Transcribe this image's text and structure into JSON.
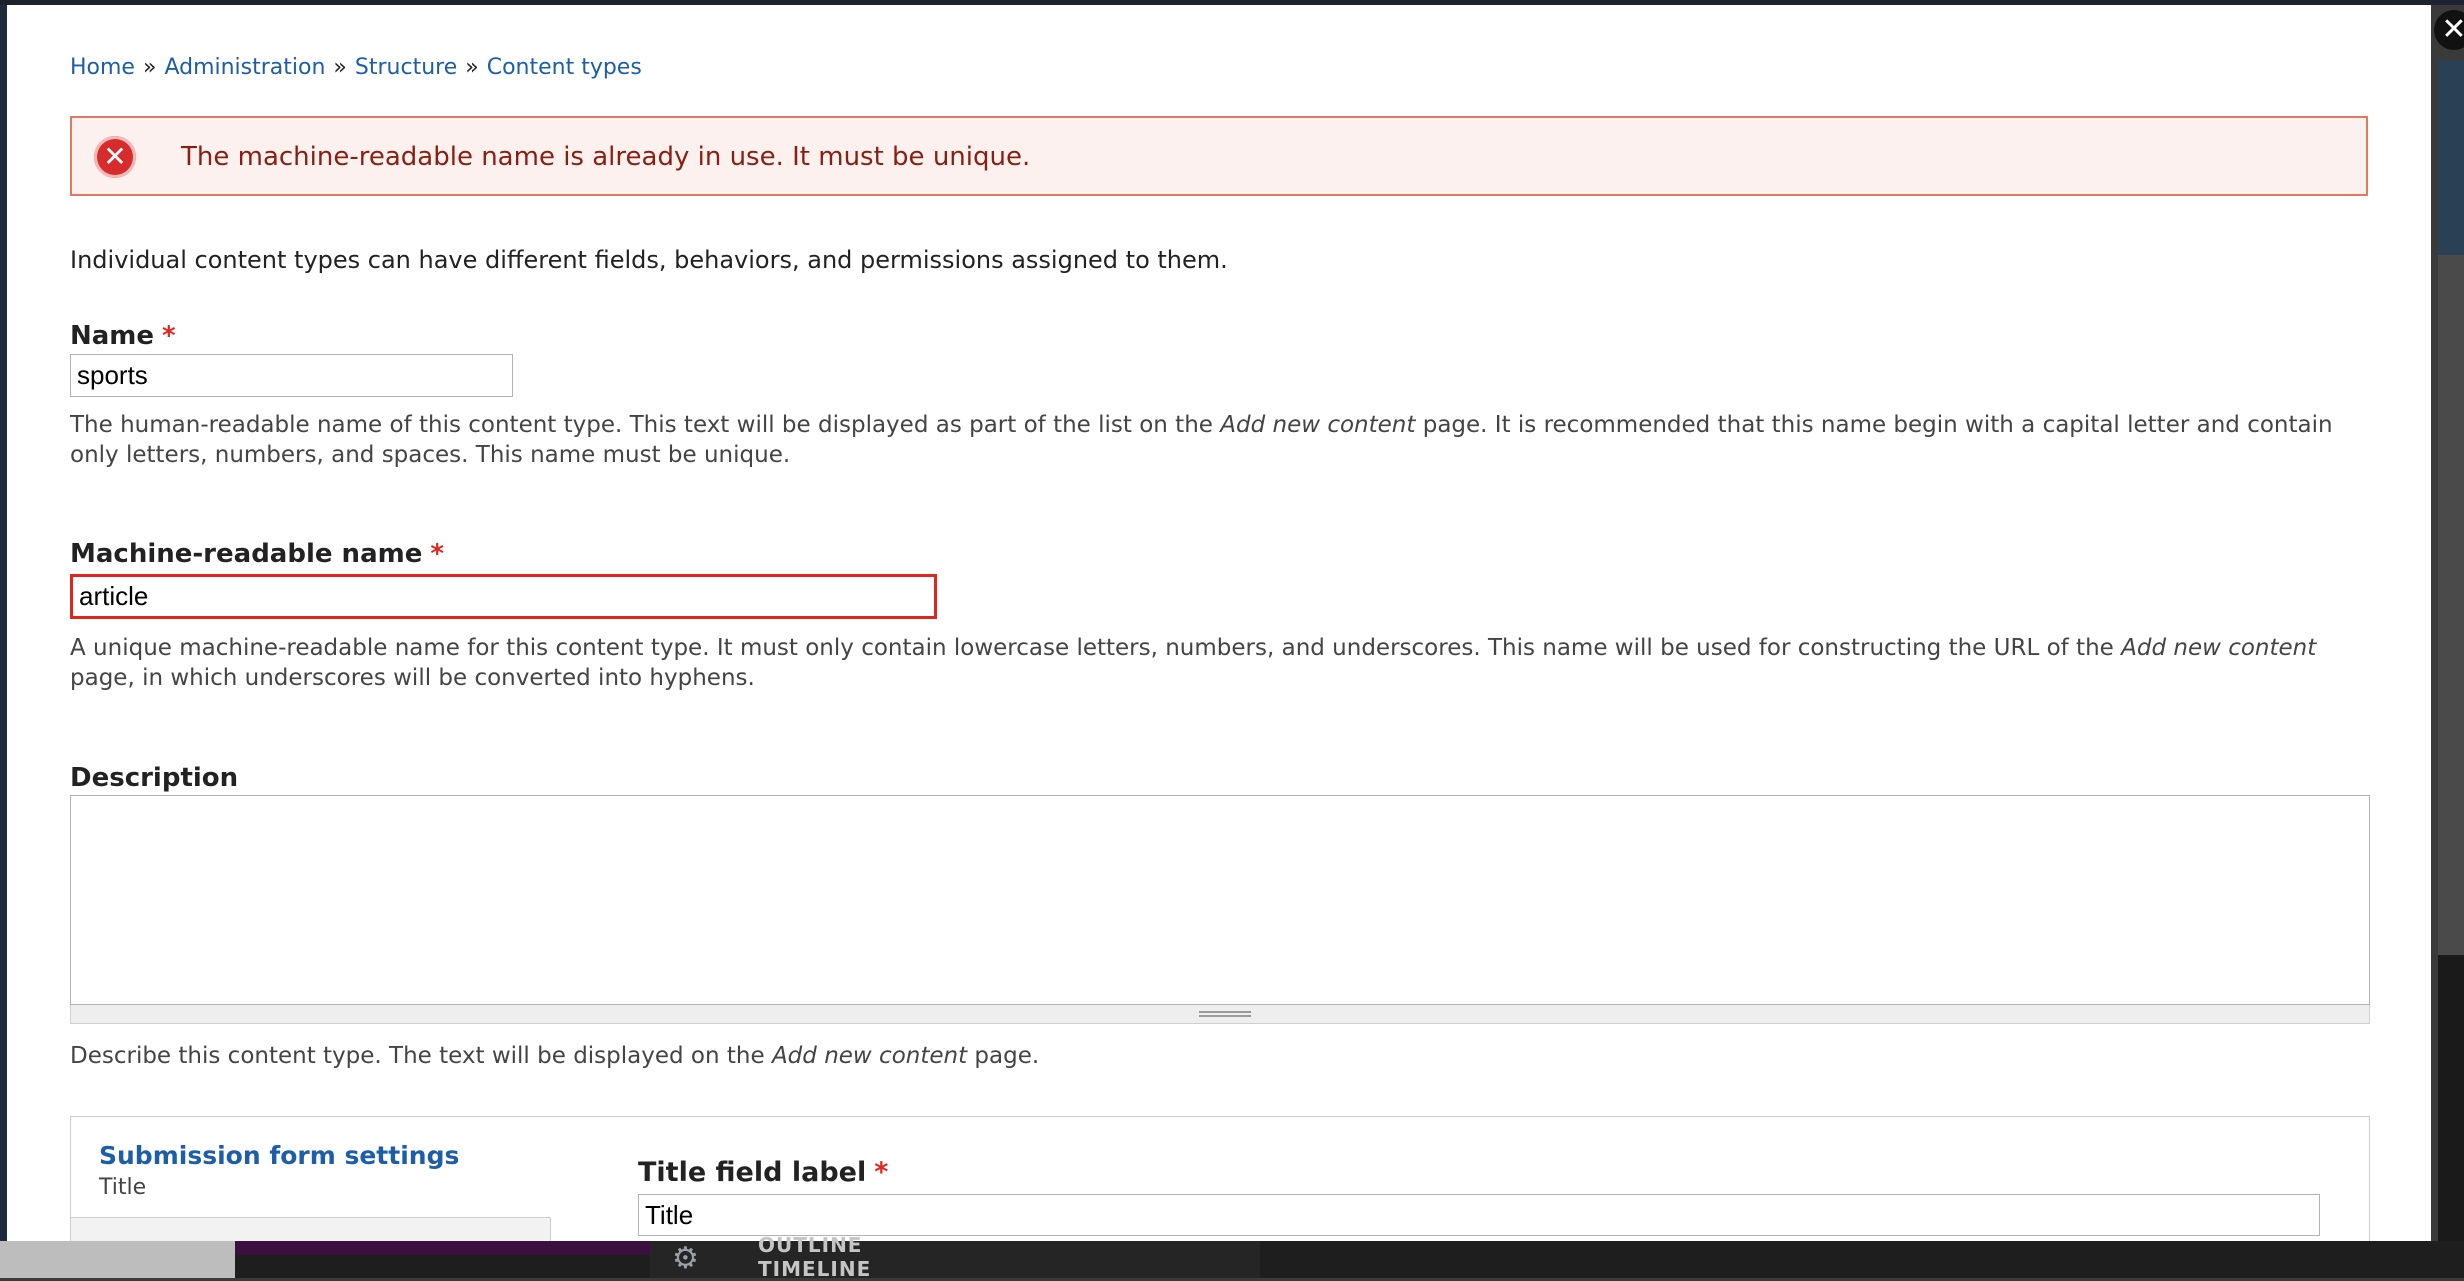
{
  "breadcrumb": {
    "home": "Home",
    "administration": "Administration",
    "structure": "Structure",
    "content_types": "Content types",
    "separator": "»"
  },
  "error": {
    "message": "The machine-readable name is already in use. It must be unique.",
    "icon": "error-x-icon"
  },
  "intro": "Individual content types can have different fields, behaviors, and permissions assigned to them.",
  "name_field": {
    "label": "Name",
    "required_mark": "*",
    "value": "sports",
    "help_before": "The human-readable name of this content type. This text will be displayed as part of the list on the ",
    "help_em": "Add new content",
    "help_after": " page. It is recommended that this name begin with a capital letter and contain",
    "help_line2": "only letters, numbers, and spaces. This name must be unique."
  },
  "machine_field": {
    "label": "Machine-readable name",
    "required_mark": "*",
    "value": "article",
    "help_before": "A unique machine-readable name for this content type. It must only contain lowercase letters, numbers, and underscores. This name will be used for constructing the URL of the ",
    "help_em": "Add new content",
    "help_line2": "page, in which underscores will be converted into hyphens."
  },
  "description_field": {
    "label": "Description",
    "value": "",
    "help_before": "Describe this content type. The text will be displayed on the ",
    "help_em": "Add new content",
    "help_after": " page."
  },
  "vertical_tabs": {
    "active_title": "Submission form settings",
    "active_summary": "Title"
  },
  "title_field": {
    "label": "Title field label",
    "required_mark": "*",
    "value": "Title"
  },
  "background_panel": {
    "outline": "OUTLINE",
    "timeline": "TIMELINE"
  },
  "colors": {
    "link": "#1d5ea8",
    "error_border": "#e3261d",
    "error_bg": "#fdf1ef",
    "error_text": "#8a1f11"
  }
}
